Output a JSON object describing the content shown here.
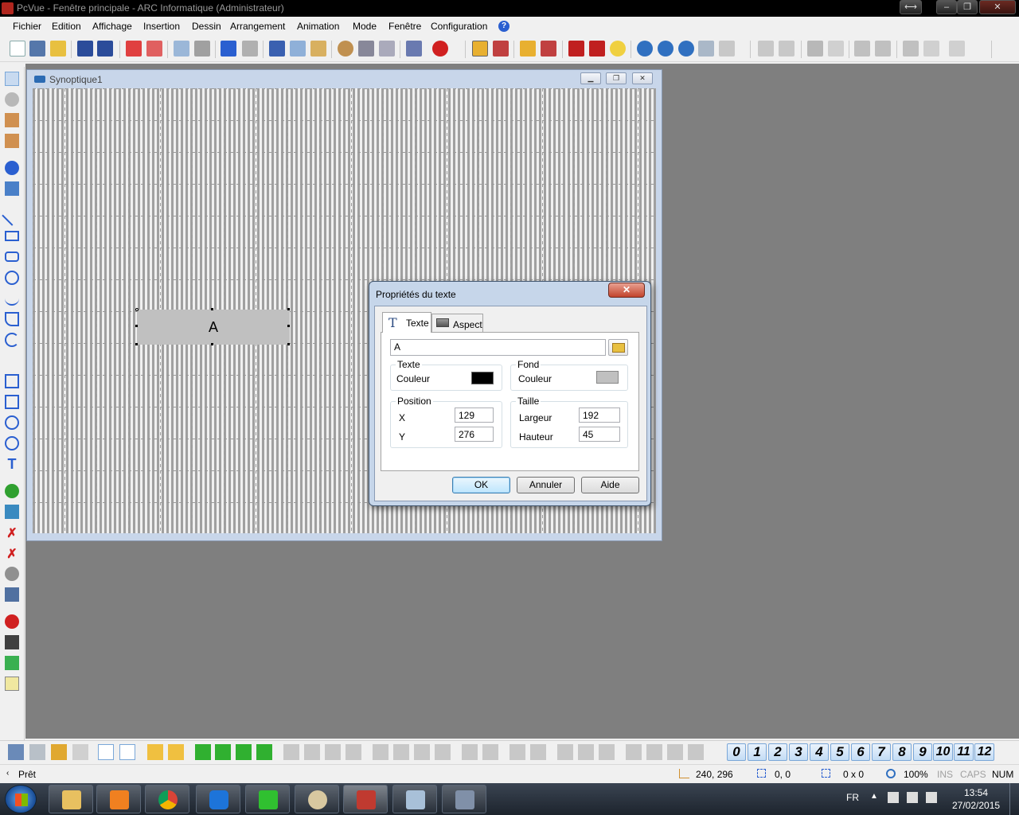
{
  "window": {
    "title": "PcVue - Fenêtre principale - ARC Informatique (Administrateur)",
    "controls": {
      "resize": "⟷",
      "minimize": "–",
      "restore": "❐",
      "close": "✕"
    }
  },
  "menu": {
    "items": [
      "Fichier",
      "Edition",
      "Affichage",
      "Insertion",
      "Dessin",
      "Arrangement",
      "Animation",
      "Mode",
      "Fenêtre",
      "Configuration"
    ],
    "help": "?"
  },
  "child_window": {
    "title": "Synoptique1",
    "text_object": {
      "label": "A"
    }
  },
  "dialog": {
    "title": "Propriétés du texte",
    "close": "✕",
    "tabs": [
      {
        "label": "Texte",
        "icon": "T"
      },
      {
        "label": "Aspect"
      }
    ],
    "text_value": "A",
    "texte_group": {
      "label": "Texte",
      "couleur_label": "Couleur",
      "color": "#000000"
    },
    "fond_group": {
      "label": "Fond",
      "couleur_label": "Couleur",
      "color": "#c0c0c0"
    },
    "position_group": {
      "label": "Position",
      "x_label": "X",
      "x_value": "129",
      "y_label": "Y",
      "y_value": "276"
    },
    "taille_group": {
      "label": "Taille",
      "largeur_label": "Largeur",
      "largeur_value": "192",
      "hauteur_label": "Hauteur",
      "hauteur_value": "45"
    },
    "buttons": {
      "ok": "OK",
      "cancel": "Annuler",
      "help": "Aide"
    }
  },
  "layers": [
    "0",
    "1",
    "2",
    "3",
    "4",
    "5",
    "6",
    "7",
    "8",
    "9",
    "10",
    "11",
    "12"
  ],
  "status": {
    "ready": "Prêt",
    "coords": "240,  296",
    "offset": "0,   0",
    "size": "0 x   0",
    "zoom": "100%",
    "ins": "INS",
    "caps": "CAPS",
    "num": "NUM"
  },
  "taskbar": {
    "lang": "FR",
    "time": "13:54",
    "date": "27/02/2015"
  },
  "colors": {
    "mdi_background": "#7f7f7f",
    "canvas_background": "#f0f0f0",
    "grid": "#a0a0a0",
    "text_object_fill": "#c0c0c0",
    "dialog_frame": "#c6d6ea"
  }
}
